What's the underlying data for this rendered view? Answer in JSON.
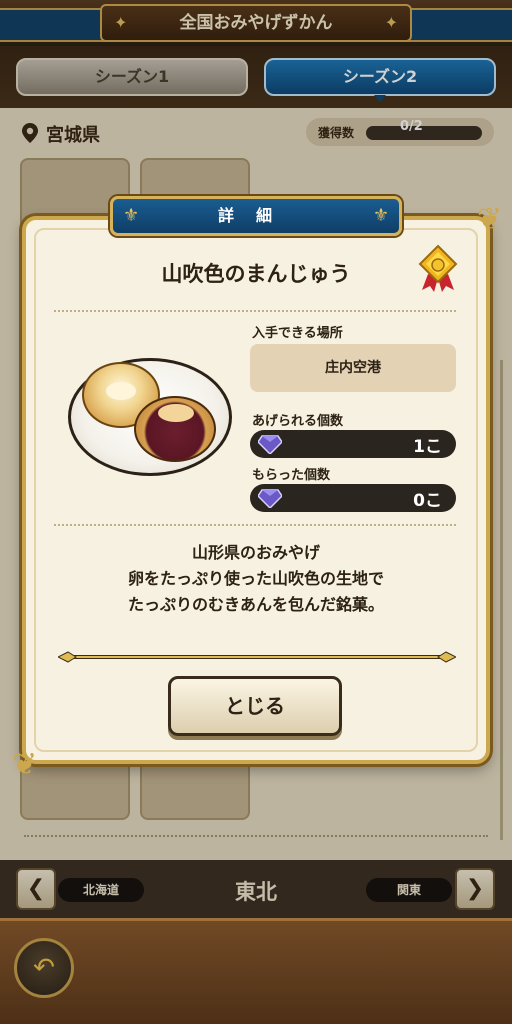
{
  "app_title": "全国おみやげずかん",
  "tabs": {
    "season1": "シーズン1",
    "season2": "シーズン2",
    "active": "season2"
  },
  "prefecture": "宮城県",
  "progress": {
    "label": "獲得数",
    "value": "0/2"
  },
  "card_placeholder": "?",
  "modal": {
    "header": "詳細",
    "item_name": "山吹色のまんじゅう",
    "location_label": "入手できる場所",
    "location_value": "庄内空港",
    "giveable_label": "あげられる個数",
    "giveable_value": "1こ",
    "received_label": "もらった個数",
    "received_value": "0こ",
    "description_lines": [
      "山形県のおみやげ",
      "卵をたっぷり使った山吹色の生地で",
      "たっぷりのむきあんを包んだ銘菓。"
    ],
    "close_label": "とじる"
  },
  "region_nav": {
    "prev": "北海道",
    "current": "東北",
    "next": "関東"
  },
  "colors": {
    "accent_gold": "#cda74d",
    "header_blue": "#1a5d92",
    "tab_active": "#1f79b6"
  },
  "icons": [
    "location-pin-icon",
    "medal-icon",
    "gem-icon",
    "chevron-left-icon",
    "chevron-right-icon",
    "back-icon"
  ]
}
